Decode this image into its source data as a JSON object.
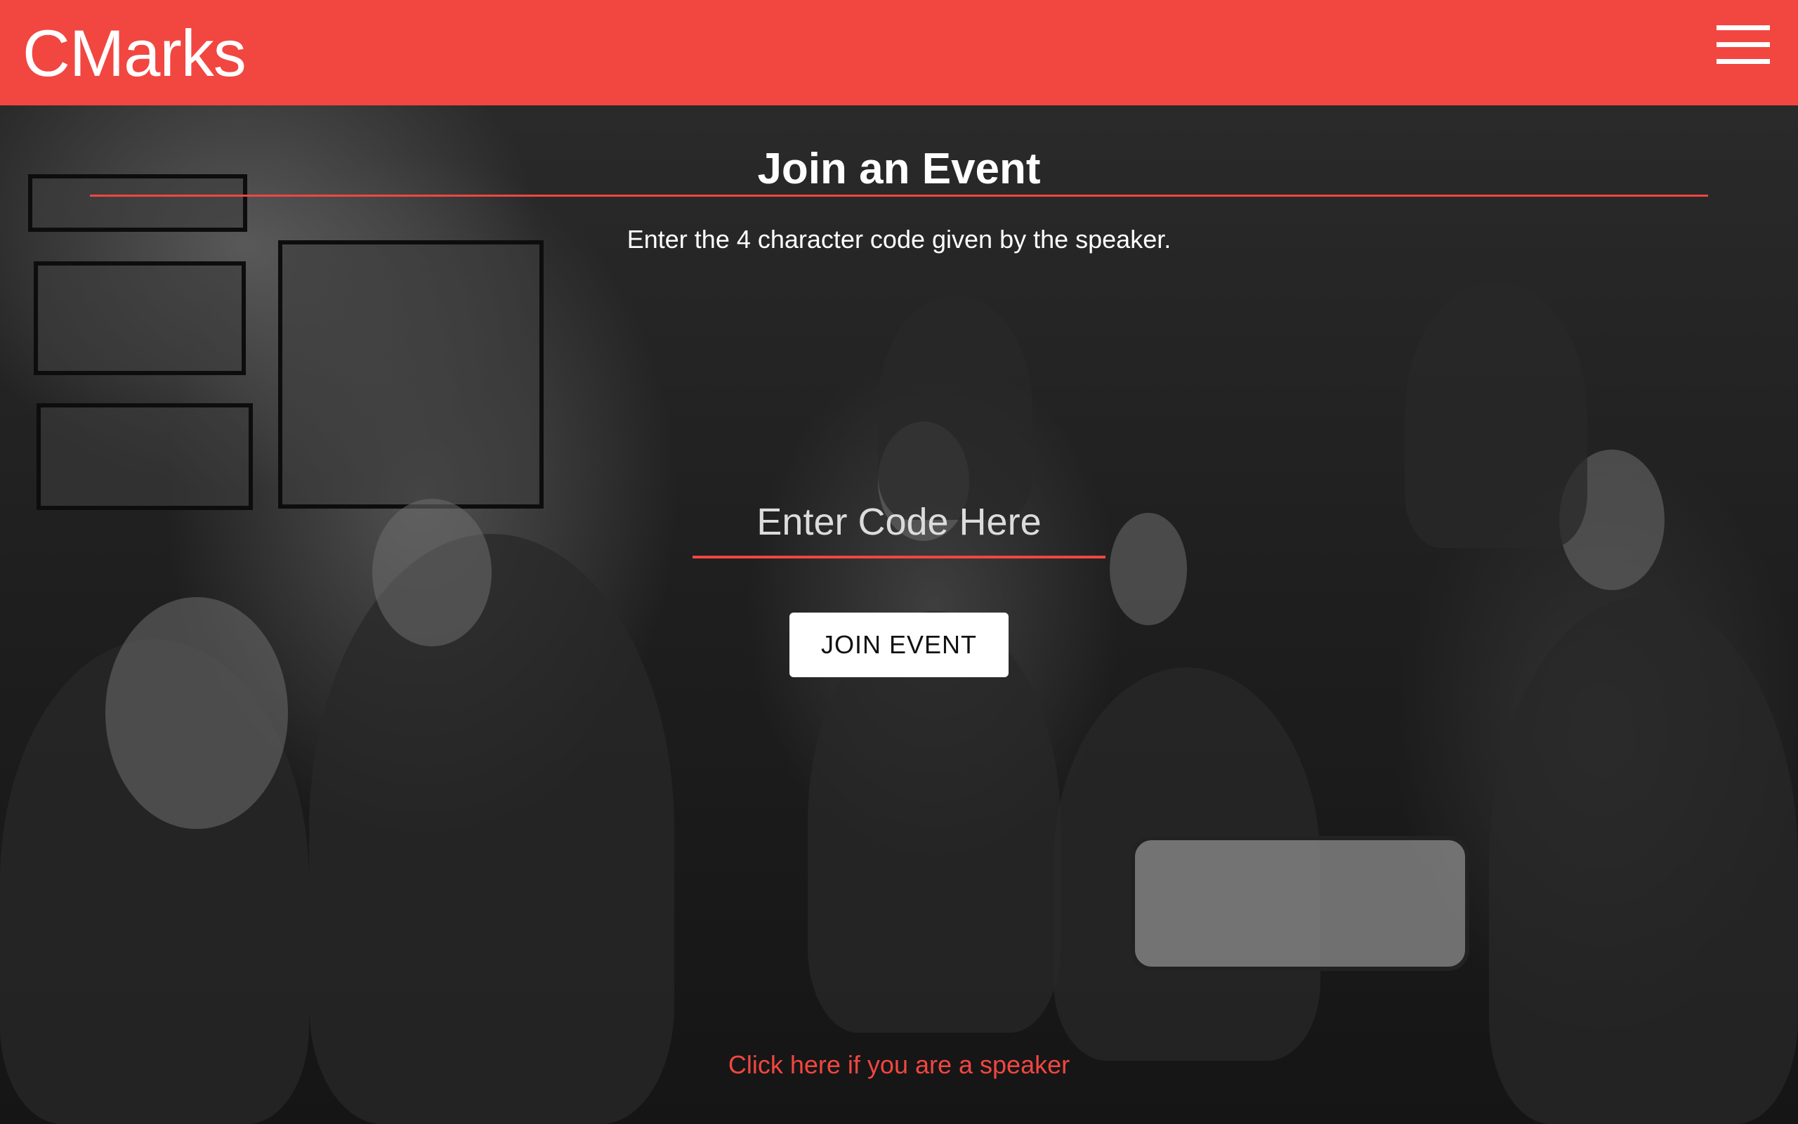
{
  "header": {
    "brand": "CMarks",
    "menu_icon": "hamburger-menu-icon",
    "background_color": "#f24641"
  },
  "main": {
    "title": "Join an Event",
    "instructions": "Enter the 4 character code given by the speaker.",
    "code_input": {
      "placeholder": "Enter Code Here",
      "value": ""
    },
    "join_button_label": "JOIN EVENT",
    "speaker_link": "Click here if you are a speaker"
  },
  "colors": {
    "accent": "#f24641",
    "text": "#ffffff",
    "button_bg": "#ffffff",
    "button_text": "#111111"
  }
}
